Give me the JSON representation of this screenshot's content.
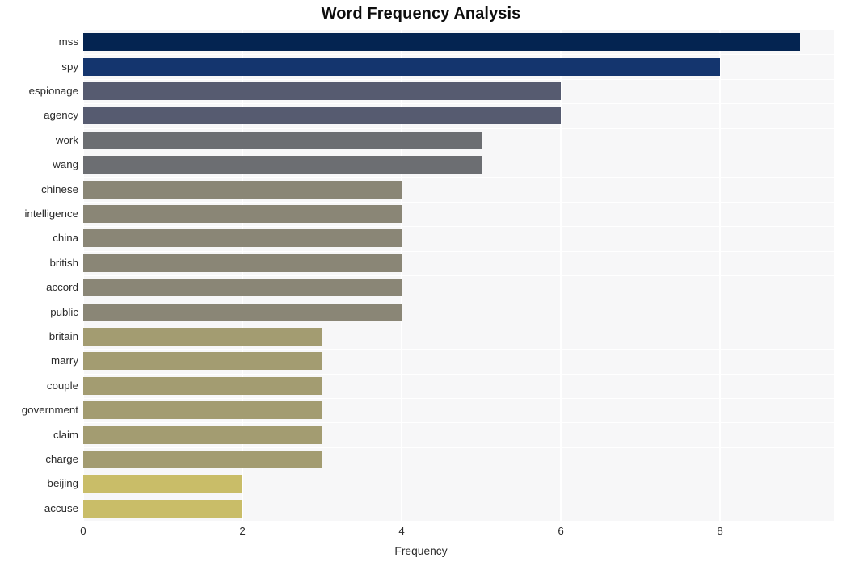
{
  "chart_data": {
    "type": "bar",
    "orientation": "horizontal",
    "title": "Word Frequency Analysis",
    "xlabel": "Frequency",
    "ylabel": "",
    "xlim": [
      0,
      9.43
    ],
    "xticks": [
      0,
      2,
      4,
      6,
      8
    ],
    "xticklabels": [
      "0",
      "2",
      "4",
      "6",
      "8"
    ],
    "grid": true,
    "grid_axis": "x",
    "legend": "none",
    "background": "#f7f7f8",
    "categories": [
      "mss",
      "spy",
      "espionage",
      "agency",
      "work",
      "wang",
      "chinese",
      "intelligence",
      "china",
      "british",
      "accord",
      "public",
      "britain",
      "marry",
      "couple",
      "government",
      "claim",
      "charge",
      "beijing",
      "accuse"
    ],
    "values": [
      9,
      8,
      6,
      6,
      5,
      5,
      4,
      4,
      4,
      4,
      4,
      4,
      3,
      3,
      3,
      3,
      3,
      3,
      2,
      2
    ],
    "bar_colors": [
      "#042451",
      "#14356e",
      "#565b70",
      "#565b70",
      "#6c6e72",
      "#6c6e72",
      "#8a8676",
      "#8a8676",
      "#8a8676",
      "#8a8676",
      "#8a8676",
      "#8a8676",
      "#a39c71",
      "#a39c71",
      "#a39c71",
      "#a39c71",
      "#a39c71",
      "#a39c71",
      "#c9bd68",
      "#c9bd68"
    ]
  },
  "colors": {
    "canvas": "#ffffff",
    "plot_background": "#f7f7f8",
    "gridline": "#ffffff",
    "text": "#2b2b2b",
    "title_text": "#0d0d0d"
  }
}
